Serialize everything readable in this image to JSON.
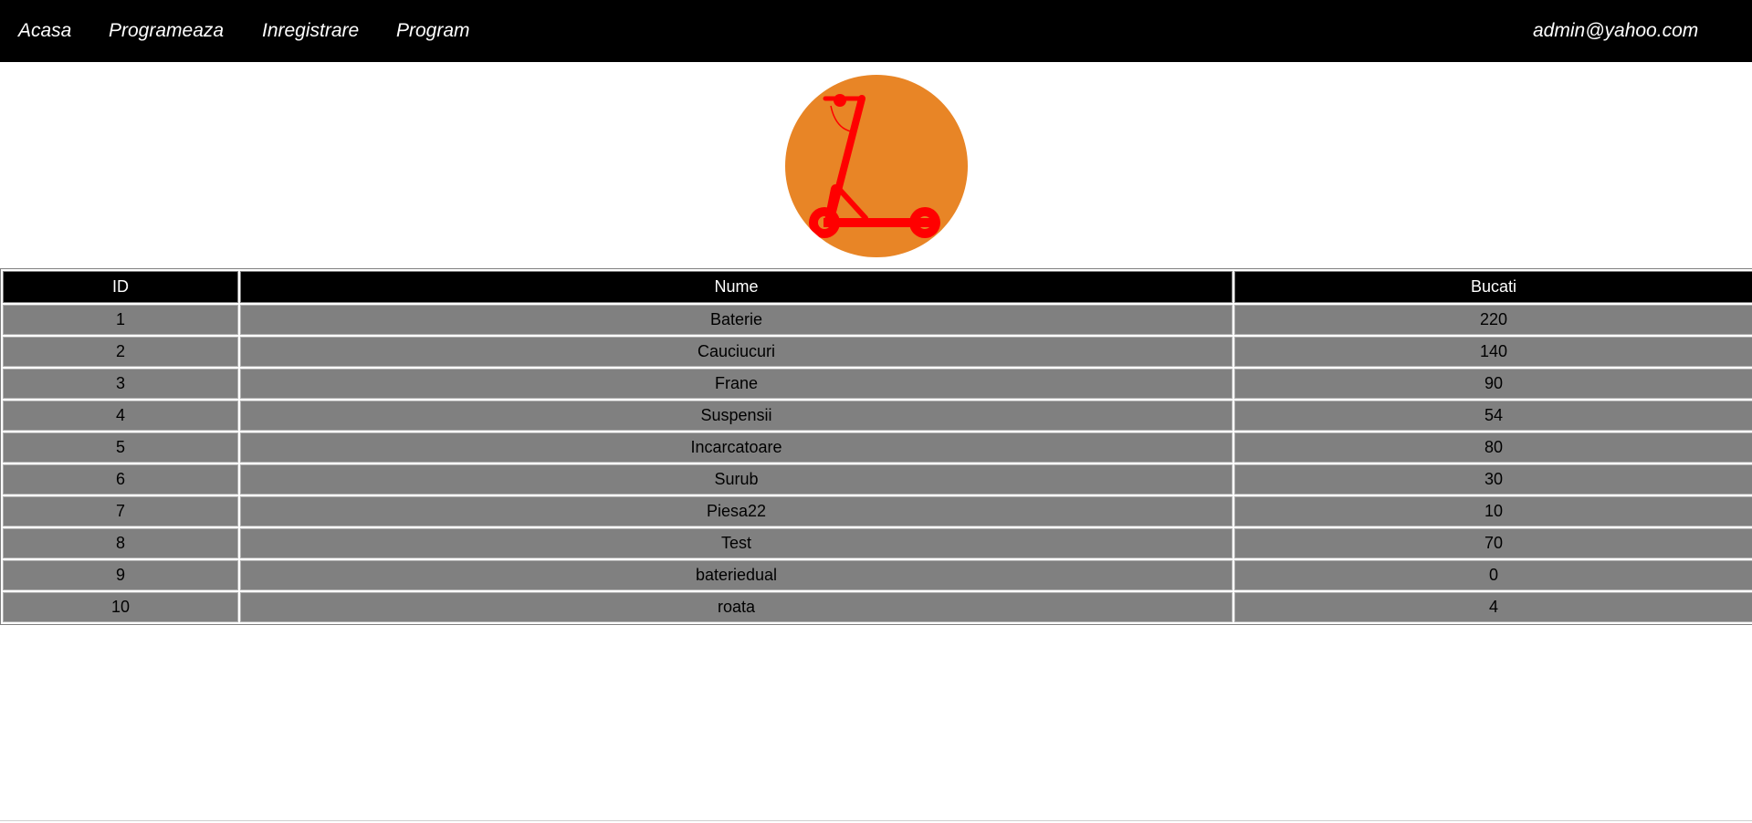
{
  "nav": {
    "links": [
      "Acasa",
      "Programeaza",
      "Inregistrare",
      "Program"
    ],
    "user_email": "admin@yahoo.com"
  },
  "logo": {
    "icon": "scooter-wrench-icon",
    "circle_color": "#E88526",
    "icon_color": "#FF0000"
  },
  "table": {
    "headers": [
      "ID",
      "Nume",
      "Bucati"
    ],
    "rows": [
      [
        "1",
        "Baterie",
        "220"
      ],
      [
        "2",
        "Cauciucuri",
        "140"
      ],
      [
        "3",
        "Frane",
        "90"
      ],
      [
        "4",
        "Suspensii",
        "54"
      ],
      [
        "5",
        "Incarcatoare",
        "80"
      ],
      [
        "6",
        "Surub",
        "30"
      ],
      [
        "7",
        "Piesa22",
        "10"
      ],
      [
        "8",
        "Test",
        "70"
      ],
      [
        "9",
        "bateriedual",
        "0"
      ],
      [
        "10",
        "roata",
        "4"
      ]
    ]
  }
}
